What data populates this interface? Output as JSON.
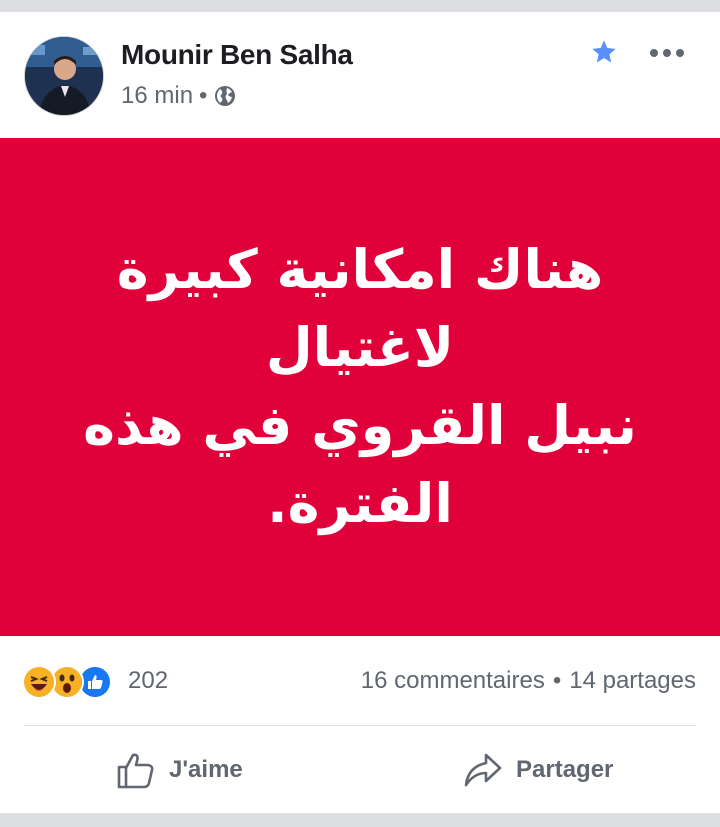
{
  "post": {
    "author": "Mounir Ben Salha",
    "time": "16 min",
    "separator": "•",
    "privacy_icon": "globe-icon",
    "favorite_icon": "star-icon",
    "more_icon": "more-horizontal-icon",
    "image": {
      "background": "#e0003a",
      "line1": "هناك امكانية كبيرة لاغتيال",
      "line2": "نبيل القروي في هذه الفترة."
    }
  },
  "stats": {
    "reactions": [
      "haha-icon",
      "wow-icon",
      "like-icon"
    ],
    "reaction_count": "202",
    "comments": "16 commentaires",
    "dot": "•",
    "shares": "14 partages"
  },
  "actions": {
    "like_label": "J'aime",
    "share_label": "Partager"
  },
  "colors": {
    "accent_blue": "#1877f2",
    "star_blue": "#5890ff",
    "text_primary": "#1c1e21",
    "text_secondary": "#606770"
  }
}
